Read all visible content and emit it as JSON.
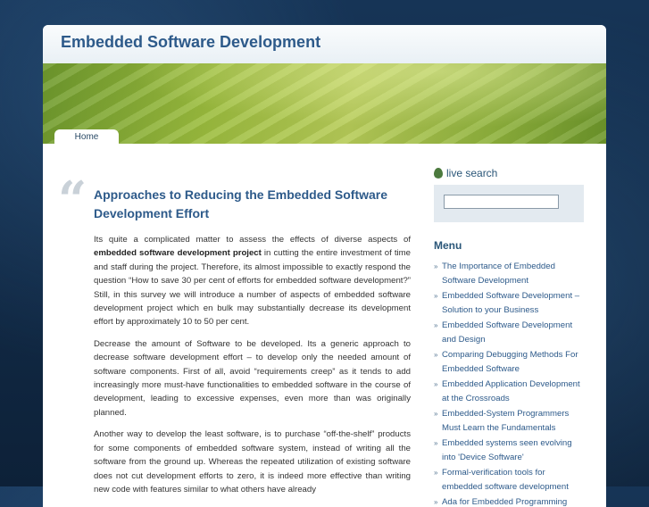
{
  "header": {
    "site_title": "Embedded Software Development"
  },
  "nav": {
    "home_label": "Home"
  },
  "post": {
    "quote_glyph": "“",
    "title": "Approaches to Reducing the Embedded Software Development Effort",
    "p1_pre": "Its quite a complicated matter to assess the effects of diverse aspects of ",
    "p1_bold": "embedded software development project",
    "p1_post": " in cutting the entire investment of time and staff during the project. Therefore, its almost impossible to exactly respond the question “How to save 30 per cent of efforts for embedded software development?” Still, in this survey we will introduce a number of aspects of embedded software development project which en bulk may substantially decrease its development effort by approximately 10 to 50 per cent.",
    "p2": "Decrease the amount of Software to be developed. Its a generic approach to decrease software development effort – to develop only the needed amount of software components. First of all, avoid “requirements creep” as it tends to add increasingly more must-have functionalities to embedded software in the course of development, leading to excessive expenses, even more than was originally planned.",
    "p3": "Another way to develop the least software, is to purchase “off-the-shelf” products for some components of embedded software system, instead of writing all the software from the ground up. Whereas the repeated utilization of existing software does not cut development efforts to zero, it is indeed more effective than writing new code with features similar to what others have already"
  },
  "sidebar": {
    "live_search_label": "live search",
    "search_value": "",
    "menu_title": "Menu",
    "arrow_glyph": "»",
    "menu_items": [
      "The Importance of Embedded Software Development",
      "Embedded Software Development – Solution to your Business",
      "Embedded Software Development and Design",
      "Comparing Debugging Methods For Embedded Software",
      "Embedded Application Development at the Crossroads",
      "Embedded-System Programmers Must Learn the Fundamentals",
      "Embedded systems seen evolving into 'Device Software'",
      "Formal-verification tools for embedded software development",
      "Ada for Embedded Programming"
    ]
  }
}
